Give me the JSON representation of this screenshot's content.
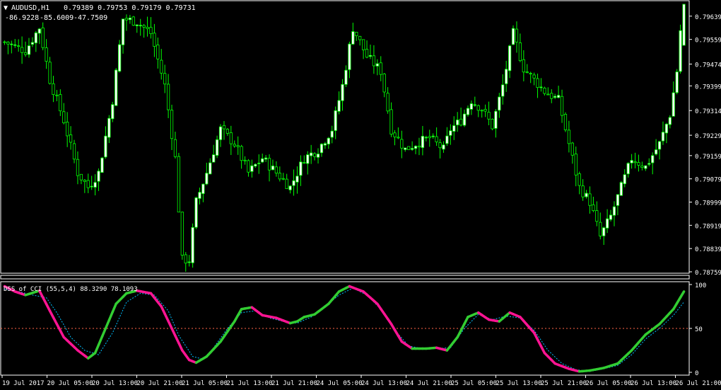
{
  "main": {
    "symbol_label": "AUDUSD,H1",
    "ohlc": "0.79389 0.79753 0.79179 0.79731",
    "values": [
      "-86.9228",
      "-85.6009",
      "-47.7509"
    ]
  },
  "indicator": {
    "label": "DSS of CCI (55,5,4) 88.3290 78.1093"
  },
  "colors": {
    "background": "#000000",
    "axis": "#ffffff",
    "bull_candle": "#ffffff",
    "bear_candle": "#000000",
    "wick": "#00ff00",
    "indicator_up": "#32cd32",
    "indicator_down": "#ff1493",
    "signal": "#00bfff",
    "level_line": "#ff6347"
  },
  "chart_data": [
    {
      "type": "candlestick",
      "title": "AUDUSD,H1",
      "y_ticks": [
        "0.79639",
        "0.79559",
        "0.79474",
        "0.79399",
        "0.79314",
        "0.79229",
        "0.79159",
        "0.79079",
        "0.78999",
        "0.78919",
        "0.78839",
        "0.78759"
      ],
      "ylim": [
        0.78759,
        0.7968
      ],
      "x_ticks": [
        "19 Jul 2017",
        "20 Jul 05:00",
        "20 Jul 13:00",
        "20 Jul 21:00",
        "21 Jul 05:00",
        "21 Jul 13:00",
        "21 Jul 21:00",
        "24 Jul 05:00",
        "24 Jul 13:00",
        "24 Jul 21:00",
        "25 Jul 05:00",
        "25 Jul 13:00",
        "25 Jul 21:00",
        "26 Jul 05:00",
        "26 Jul 13:00",
        "26 Jul 21:00"
      ],
      "close_keypoints": [
        [
          0,
          0.7955
        ],
        [
          6,
          0.7952
        ],
        [
          10,
          0.796
        ],
        [
          13,
          0.7942
        ],
        [
          17,
          0.7928
        ],
        [
          21,
          0.791
        ],
        [
          24,
          0.7905
        ],
        [
          27,
          0.791
        ],
        [
          31,
          0.7935
        ],
        [
          34,
          0.7963
        ],
        [
          38,
          0.7962
        ],
        [
          42,
          0.7958
        ],
        [
          46,
          0.794
        ],
        [
          49,
          0.7915
        ],
        [
          51,
          0.788
        ],
        [
          53,
          0.788
        ],
        [
          55,
          0.79
        ],
        [
          58,
          0.791
        ],
        [
          62,
          0.7925
        ],
        [
          66,
          0.792
        ],
        [
          70,
          0.791
        ],
        [
          74,
          0.7915
        ],
        [
          78,
          0.791
        ],
        [
          82,
          0.7905
        ],
        [
          86,
          0.7915
        ],
        [
          90,
          0.7918
        ],
        [
          94,
          0.7925
        ],
        [
          97,
          0.794
        ],
        [
          100,
          0.796
        ],
        [
          104,
          0.795
        ],
        [
          108,
          0.7945
        ],
        [
          111,
          0.7925
        ],
        [
          115,
          0.7918
        ],
        [
          118,
          0.792
        ],
        [
          122,
          0.7922
        ],
        [
          126,
          0.7918
        ],
        [
          128,
          0.7925
        ],
        [
          131,
          0.7928
        ],
        [
          134,
          0.7935
        ],
        [
          137,
          0.7932
        ],
        [
          140,
          0.7926
        ],
        [
          143,
          0.794
        ],
        [
          146,
          0.7958
        ],
        [
          149,
          0.7946
        ],
        [
          152,
          0.7942
        ],
        [
          155,
          0.7938
        ],
        [
          159,
          0.7935
        ],
        [
          162,
          0.792
        ],
        [
          165,
          0.7905
        ],
        [
          168,
          0.79
        ],
        [
          171,
          0.7888
        ],
        [
          174,
          0.7895
        ],
        [
          177,
          0.7905
        ],
        [
          180,
          0.7915
        ],
        [
          184,
          0.7912
        ],
        [
          188,
          0.792
        ],
        [
          191,
          0.793
        ],
        [
          193,
          0.7945
        ],
        [
          195,
          0.7973
        ]
      ],
      "candle_count": 196
    },
    {
      "type": "line",
      "title": "DSS of CCI (55,5,4) 88.3290 78.1093",
      "y_ticks": [
        "100",
        "50",
        "0"
      ],
      "ylim": [
        0,
        100
      ],
      "level": 50,
      "series": [
        {
          "name": "DSS",
          "keypoints": [
            [
              0,
              98
            ],
            [
              3,
              92
            ],
            [
              6,
              88
            ],
            [
              10,
              93
            ],
            [
              13,
              70
            ],
            [
              17,
              40
            ],
            [
              21,
              25
            ],
            [
              24,
              16
            ],
            [
              26,
              22
            ],
            [
              29,
              50
            ],
            [
              32,
              78
            ],
            [
              35,
              90
            ],
            [
              38,
              93
            ],
            [
              42,
              90
            ],
            [
              45,
              75
            ],
            [
              48,
              50
            ],
            [
              51,
              25
            ],
            [
              53,
              14
            ],
            [
              55,
              11
            ],
            [
              58,
              18
            ],
            [
              62,
              35
            ],
            [
              66,
              58
            ],
            [
              68,
              72
            ],
            [
              71,
              74
            ],
            [
              74,
              65
            ],
            [
              78,
              62
            ],
            [
              82,
              56
            ],
            [
              84,
              58
            ],
            [
              86,
              63
            ],
            [
              89,
              66
            ],
            [
              93,
              78
            ],
            [
              96,
              92
            ],
            [
              99,
              98
            ],
            [
              103,
              92
            ],
            [
              107,
              78
            ],
            [
              111,
              55
            ],
            [
              114,
              35
            ],
            [
              117,
              27
            ],
            [
              121,
              27
            ],
            [
              124,
              28
            ],
            [
              127,
              25
            ],
            [
              130,
              40
            ],
            [
              133,
              63
            ],
            [
              136,
              68
            ],
            [
              139,
              60
            ],
            [
              142,
              58
            ],
            [
              145,
              68
            ],
            [
              148,
              63
            ],
            [
              152,
              45
            ],
            [
              155,
              22
            ],
            [
              158,
              10
            ],
            [
              162,
              4
            ],
            [
              165,
              1
            ],
            [
              168,
              2
            ],
            [
              172,
              5
            ],
            [
              176,
              10
            ],
            [
              180,
              25
            ],
            [
              184,
              43
            ],
            [
              188,
              55
            ],
            [
              192,
              72
            ],
            [
              195,
              92
            ]
          ]
        },
        {
          "name": "Signal",
          "keypoints": [
            [
              0,
              95
            ],
            [
              4,
              92
            ],
            [
              8,
              88
            ],
            [
              12,
              85
            ],
            [
              15,
              68
            ],
            [
              19,
              40
            ],
            [
              23,
              25
            ],
            [
              27,
              20
            ],
            [
              31,
              45
            ],
            [
              35,
              80
            ],
            [
              39,
              90
            ],
            [
              43,
              88
            ],
            [
              47,
              70
            ],
            [
              50,
              42
            ],
            [
              54,
              18
            ],
            [
              57,
              15
            ],
            [
              60,
              28
            ],
            [
              64,
              50
            ],
            [
              68,
              68
            ],
            [
              72,
              70
            ],
            [
              76,
              62
            ],
            [
              80,
              58
            ],
            [
              84,
              56
            ],
            [
              88,
              63
            ],
            [
              92,
              75
            ],
            [
              96,
              88
            ],
            [
              100,
              96
            ],
            [
              104,
              88
            ],
            [
              108,
              72
            ],
            [
              112,
              48
            ],
            [
              116,
              30
            ],
            [
              120,
              27
            ],
            [
              124,
              27
            ],
            [
              128,
              28
            ],
            [
              132,
              50
            ],
            [
              136,
              66
            ],
            [
              140,
              60
            ],
            [
              144,
              64
            ],
            [
              148,
              62
            ],
            [
              152,
              48
            ],
            [
              156,
              25
            ],
            [
              160,
              10
            ],
            [
              164,
              3
            ],
            [
              168,
              1
            ],
            [
              172,
              4
            ],
            [
              176,
              8
            ],
            [
              180,
              20
            ],
            [
              184,
              38
            ],
            [
              188,
              50
            ],
            [
              192,
              65
            ],
            [
              195,
              80
            ]
          ]
        }
      ]
    }
  ]
}
